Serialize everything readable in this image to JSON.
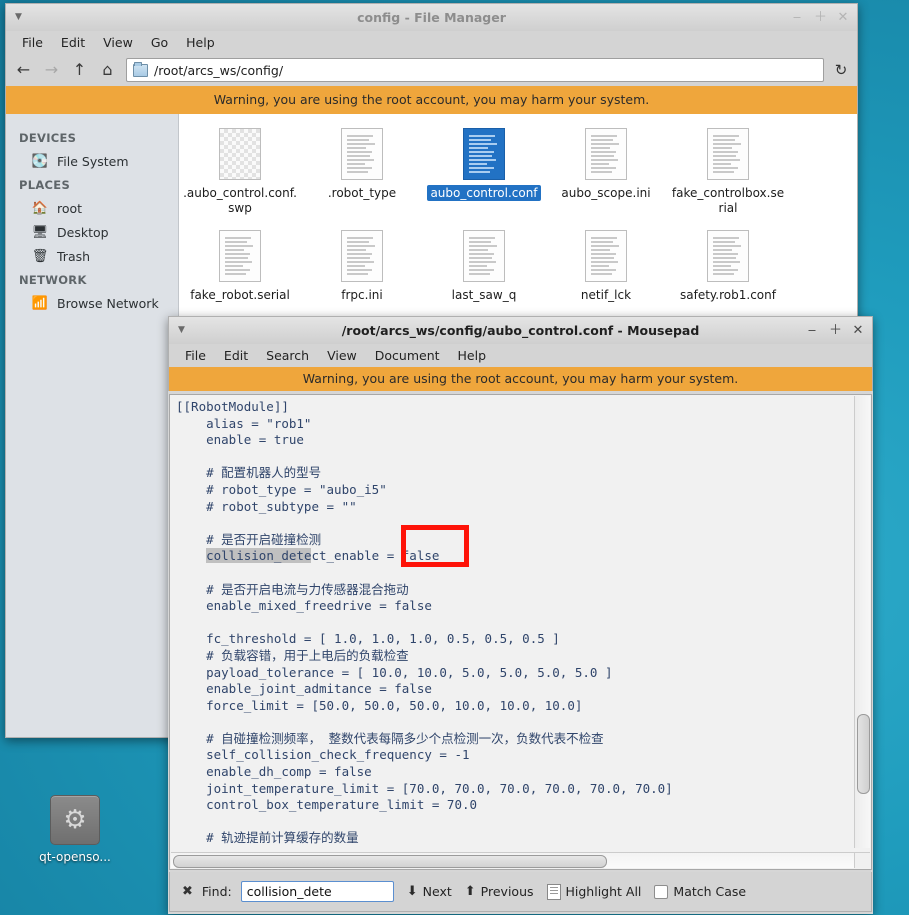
{
  "desktop": {
    "icon": {
      "name": "gear-icon",
      "glyph": "⚙",
      "label": "qt-openso..."
    }
  },
  "file_manager": {
    "title": "config - File Manager",
    "window_buttons": {
      "minimize": "‒",
      "maximize": "＋",
      "close": "✕",
      "menu": "▼"
    },
    "menu": [
      "File",
      "Edit",
      "View",
      "Go",
      "Help"
    ],
    "toolbar": {
      "back": "←",
      "forward": "→",
      "up": "↑",
      "home": "⌂",
      "reload": "↻",
      "path": "/root/arcs_ws/config/"
    },
    "warning": "Warning, you are using the root account, you may harm your system.",
    "sidebar": [
      {
        "type": "header",
        "label": "DEVICES"
      },
      {
        "type": "item",
        "label": "File System",
        "icon": "hard-disk-icon",
        "glyph": "💽"
      },
      {
        "type": "header",
        "label": "PLACES"
      },
      {
        "type": "item",
        "label": "root",
        "icon": "home-icon",
        "glyph": "🏠"
      },
      {
        "type": "item",
        "label": "Desktop",
        "icon": "desktop-icon",
        "glyph": "🖥"
      },
      {
        "type": "item",
        "label": "Trash",
        "icon": "trash-icon",
        "glyph": "🗑"
      },
      {
        "type": "header",
        "label": "NETWORK"
      },
      {
        "type": "item",
        "label": "Browse Network",
        "icon": "wifi-icon",
        "glyph": "📶"
      }
    ],
    "files": [
      {
        "name": ".aubo_control.conf.swp",
        "selected": false,
        "style": "swap"
      },
      {
        "name": ".robot_type",
        "selected": false,
        "style": "text"
      },
      {
        "name": "aubo_control.conf",
        "selected": true,
        "style": "text"
      },
      {
        "name": "aubo_scope.ini",
        "selected": false,
        "style": "text"
      },
      {
        "name": "fake_controlbox.serial",
        "selected": false,
        "style": "text"
      },
      {
        "name": "fake_robot.serial",
        "selected": false,
        "style": "text"
      },
      {
        "name": "frpc.ini",
        "selected": false,
        "style": "text"
      },
      {
        "name": "last_saw_q",
        "selected": false,
        "style": "text"
      },
      {
        "name": "netif_lck",
        "selected": false,
        "style": "text"
      },
      {
        "name": "safety.rob1.conf",
        "selected": false,
        "style": "text"
      }
    ]
  },
  "mousepad": {
    "title": "/root/arcs_ws/config/aubo_control.conf - Mousepad",
    "window_buttons": {
      "minimize": "‒",
      "maximize": "＋",
      "close": "✕",
      "menu": "▼"
    },
    "menu": [
      "File",
      "Edit",
      "Search",
      "View",
      "Document",
      "Help"
    ],
    "warning": "Warning, you are using the root account, you may harm your system.",
    "content_before": "[[RobotModule]]\n    alias = \"rob1\"\n    enable = true\n\n    # 配置机器人的型号\n    # robot_type = \"aubo_i5\"\n    # robot_subtype = \"\"\n\n    # 是否开启碰撞检测\n    ",
    "match_text": "collision_dete",
    "content_after": "ct_enable = false\n\n    # 是否开启电流与力传感器混合拖动\n    enable_mixed_freedrive = false\n\n    fc_threshold = [ 1.0, 1.0, 1.0, 0.5, 0.5, 0.5 ]\n    # 负载容错，用于上电后的负载检查\n    payload_tolerance = [ 10.0, 10.0, 5.0, 5.0, 5.0, 5.0 ]\n    enable_joint_admitance = false\n    force_limit = [50.0, 50.0, 50.0, 10.0, 10.0, 10.0]\n\n    # 自碰撞检测频率， 整数代表每隔多少个点检测一次，负数代表不检查\n    self_collision_check_frequency = -1\n    enable_dh_comp = false\n    joint_temperature_limit = [70.0, 70.0, 70.0, 70.0, 70.0, 70.0]\n    control_box_temperature_limit = 70.0\n\n    # 轨迹提前计算缓存的数量",
    "find_bar": {
      "close": "✖",
      "label": "Find:",
      "value": "collision_dete",
      "placeholder": "Find",
      "next": "Next",
      "next_icon": "⬇",
      "previous": "Previous",
      "previous_icon": "⬆",
      "highlight_all": "Highlight All",
      "match_case": "Match Case",
      "match_case_checked": false
    }
  },
  "annotation": {
    "color": "#fe1308",
    "target": "false"
  }
}
